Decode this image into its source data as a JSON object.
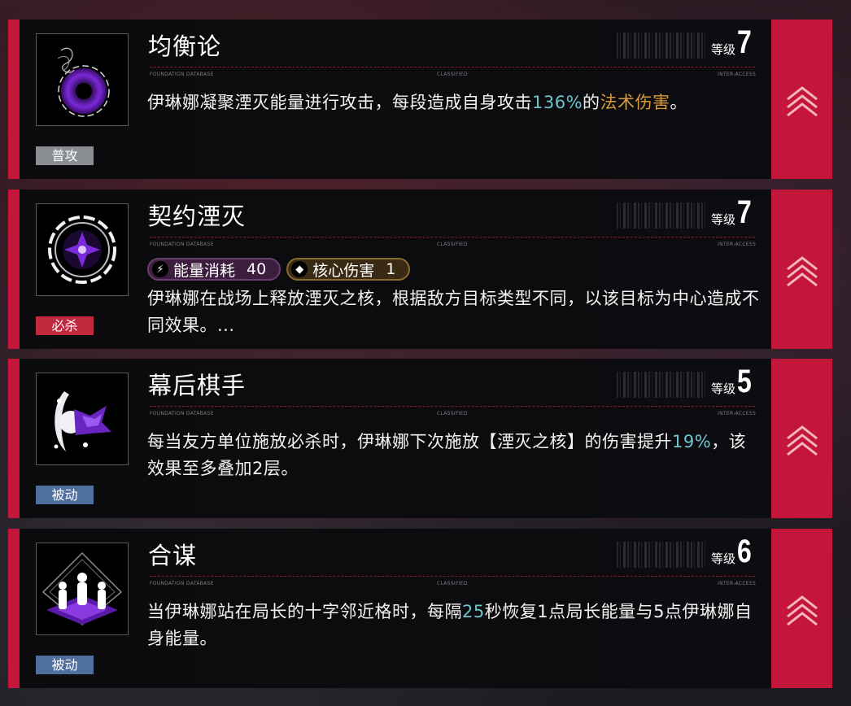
{
  "skills": [
    {
      "title": "均衡论",
      "level_label": "等级",
      "level": "7",
      "tag": "普攻",
      "micro": [
        "FOUNDATION DATABASE",
        "CLASSIFIED",
        "INTER-ACCESS"
      ],
      "desc_parts": [
        "伊琳娜凝聚湮灭能量进行攻击，每段造成自身攻击",
        "136%",
        "的",
        "法术伤害",
        "。"
      ],
      "icon": "vortex-icon"
    },
    {
      "title": "契约湮灭",
      "level_label": "等级",
      "level": "7",
      "tag": "必杀",
      "micro": [
        "FOUNDATION DATABASE",
        "CLASSIFIED",
        "INTER-ACCESS"
      ],
      "chips": [
        {
          "icon": "lightning-icon",
          "label": "能量消耗",
          "value": "40"
        },
        {
          "icon": "diamond-icon",
          "label": "核心伤害",
          "value": "1"
        }
      ],
      "desc": "伊琳娜在战场上释放湮灭之核，根据敌方目标类型不同，以该目标为中心造成不同效果。...",
      "icon": "annihilation-core-icon"
    },
    {
      "title": "幕后棋手",
      "level_label": "等级",
      "level": "5",
      "tag": "被动",
      "micro": [
        "FOUNDATION DATABASE",
        "CLASSIFIED",
        "INTER-ACCESS"
      ],
      "desc_parts": [
        "每当友方单位施放必杀时，伊琳娜下次施放【湮灭之核】的伤害提升",
        "19%",
        "，该效果至多叠加2层。"
      ],
      "icon": "splash-crown-icon"
    },
    {
      "title": "合谋",
      "level_label": "等级",
      "level": "6",
      "tag": "被动",
      "micro": [
        "FOUNDATION DATABASE",
        "CLASSIFIED",
        "INTER-ACCESS"
      ],
      "desc_parts": [
        "当伊琳娜站在局长的十字邻近格时，每隔",
        "25",
        "秒恢复1点局长能量与5点伊琳娜自身能量。"
      ],
      "icon": "three-figures-icon"
    }
  ],
  "colors": {
    "accent": "#c3163a",
    "highlight_blue": "#6cc4cf",
    "highlight_gold": "#d89a3c",
    "tag_normal": "#8a8d92",
    "tag_ult": "#c0283d",
    "tag_passive": "#4f6f9f"
  },
  "side_icon": "upgrade-chevrons-icon"
}
